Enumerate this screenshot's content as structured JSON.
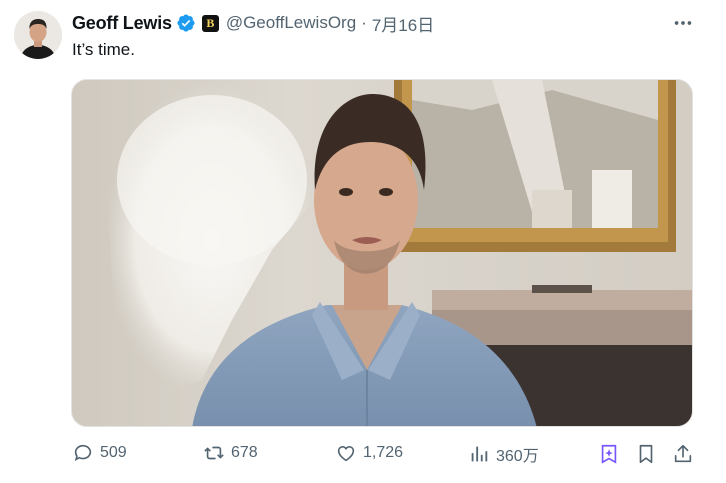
{
  "author": {
    "name": "Geoff Lewis",
    "handle": "@GeoffLewisOrg",
    "separator": "·",
    "date": "7月16日",
    "affiliate_badge": "B"
  },
  "tweet": {
    "text": "It’s time."
  },
  "stats": {
    "replies": "509",
    "reposts": "678",
    "likes": "1,726",
    "views": "360万"
  },
  "icons": {
    "verified": "verified-badge-icon",
    "more": "more-icon",
    "reply": "reply-icon",
    "repost": "repost-icon",
    "like": "like-icon",
    "views": "views-icon",
    "grok": "grok-icon",
    "bookmark": "bookmark-icon",
    "share": "share-icon"
  },
  "colors": {
    "verified": "#1d9bf0",
    "grok": "#7856ff",
    "text_secondary": "#536471"
  }
}
